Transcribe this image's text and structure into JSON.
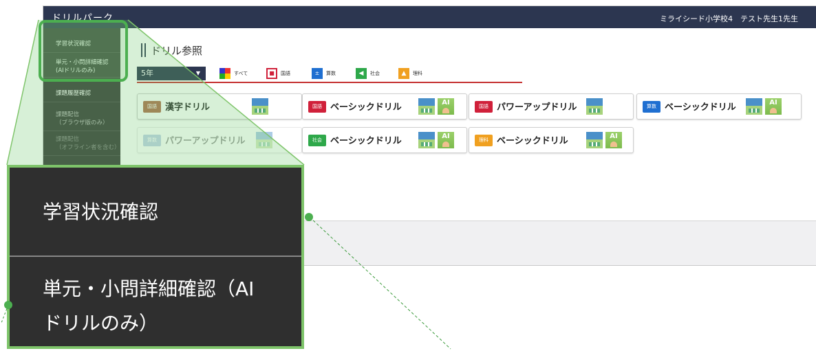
{
  "app": {
    "brand": "ドリルパーク",
    "user": "ミライシード小学校4　テスト先生1先生"
  },
  "sidebar": {
    "items": [
      {
        "label": "学習状況確認"
      },
      {
        "label": "単元・小問詳細確認"
      },
      {
        "label": "(AIドリルのみ)"
      },
      {
        "label": "課題履歴確認"
      },
      {
        "label": "課題配信"
      },
      {
        "label": "（ブラウザ版のみ）"
      },
      {
        "label": "課題配信"
      },
      {
        "label": "（オフライン者を含む）"
      }
    ]
  },
  "page": {
    "title": "ドリル参照"
  },
  "grade_select": {
    "value": "5年"
  },
  "filters": [
    {
      "label": "すべて"
    },
    {
      "label": "国語"
    },
    {
      "label": "算数"
    },
    {
      "label": "社会"
    },
    {
      "label": "理科"
    }
  ],
  "cards": [
    {
      "badge": "国語",
      "title": "漢字ドリル",
      "badge_color": "#b07050"
    },
    {
      "badge": "国語",
      "title": "ベーシックドリル",
      "badge_color": "#d0203a"
    },
    {
      "badge": "国語",
      "title": "パワーアップドリル",
      "badge_color": "#d0203a"
    },
    {
      "badge": "算数",
      "title": "ベーシックドリル",
      "badge_color": "#1f6fd1"
    },
    {
      "badge": "算数",
      "title": "パワーアップドリル",
      "badge_color": "#7aa0d0"
    },
    {
      "badge": "社会",
      "title": "ベーシックドリル",
      "badge_color": "#2ea84a"
    },
    {
      "badge": "理科",
      "title": "ベーシックドリル",
      "badge_color": "#f0a020"
    }
  ],
  "icons": {
    "common": "共通",
    "ai": "AI"
  },
  "zoom": {
    "item1": "学習状況確認",
    "item2_line1": "単元・小問詳細確認（AI",
    "item2_line2": "ドリルのみ）"
  },
  "colors": {
    "nav": "#2c3650",
    "sidebar": "#3a3a3a",
    "highlight": "#4caf50",
    "tab_line": "#c53030"
  }
}
